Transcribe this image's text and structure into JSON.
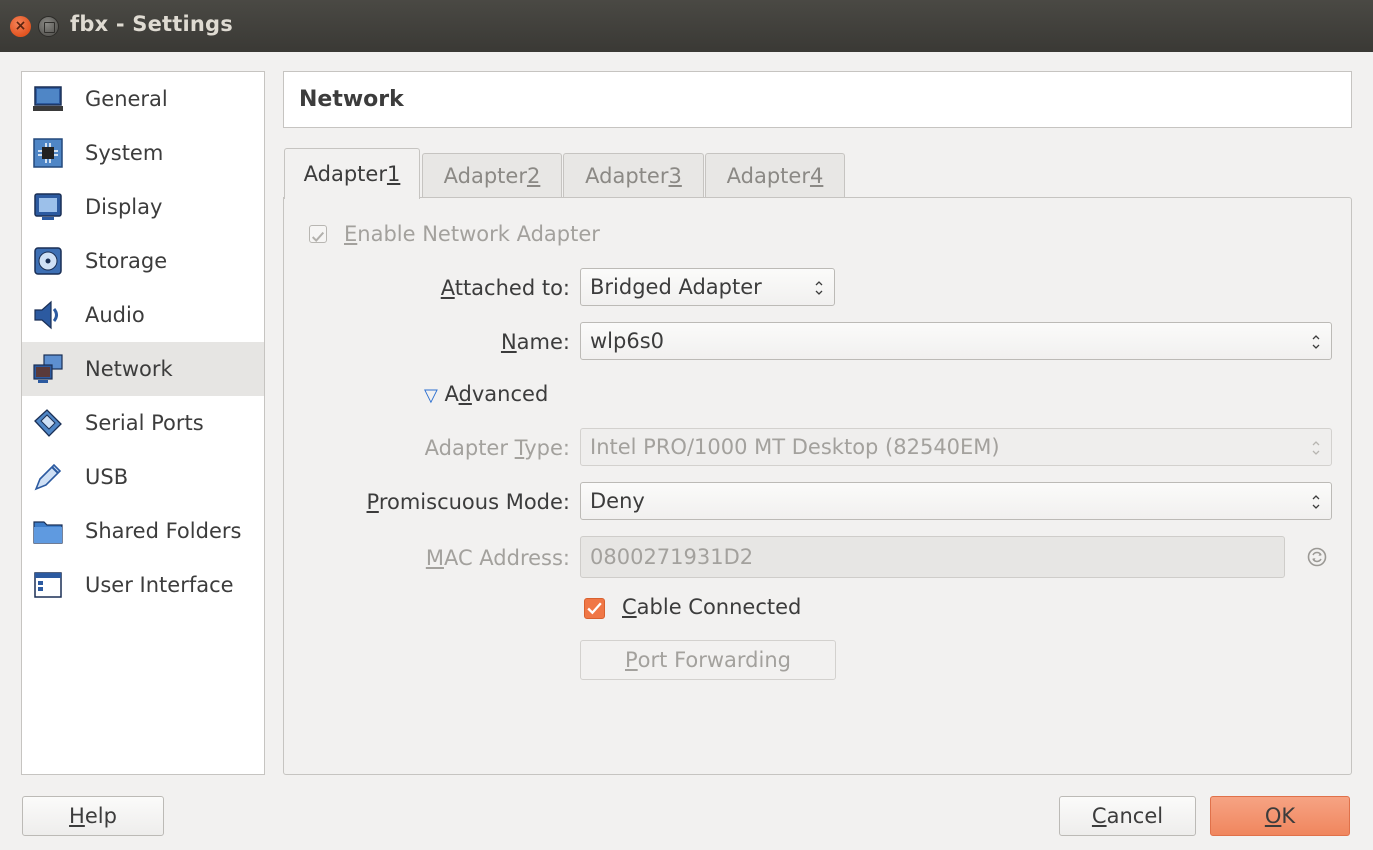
{
  "window": {
    "title": "fbx - Settings",
    "close_glyph": "×"
  },
  "sidebar": {
    "items": [
      {
        "label": "General",
        "icon": "monitor-icon"
      },
      {
        "label": "System",
        "icon": "chip-icon"
      },
      {
        "label": "Display",
        "icon": "display-icon"
      },
      {
        "label": "Storage",
        "icon": "disk-icon"
      },
      {
        "label": "Audio",
        "icon": "speaker-icon"
      },
      {
        "label": "Network",
        "icon": "network-icon",
        "selected": true
      },
      {
        "label": "Serial Ports",
        "icon": "serial-port-icon"
      },
      {
        "label": "USB",
        "icon": "usb-icon"
      },
      {
        "label": "Shared Folders",
        "icon": "folder-icon"
      },
      {
        "label": "User Interface",
        "icon": "window-icon"
      }
    ]
  },
  "page": {
    "title": "Network"
  },
  "tabs": [
    {
      "label_pre": "Adapter ",
      "mnemonic": "1",
      "active": true
    },
    {
      "label_pre": "Adapter ",
      "mnemonic": "2"
    },
    {
      "label_pre": "Adapter ",
      "mnemonic": "3"
    },
    {
      "label_pre": "Adapter ",
      "mnemonic": "4"
    }
  ],
  "adapter": {
    "enable": {
      "mnemonic": "E",
      "rest": "nable Network Adapter",
      "checked": true
    },
    "attached_to": {
      "label_mnemonic": "A",
      "label_rest": "ttached to:",
      "value": "Bridged Adapter"
    },
    "name": {
      "label_mnemonic": "N",
      "label_rest": "ame:",
      "value": "wlp6s0"
    },
    "advanced": {
      "pre": "A",
      "mnemonic": "d",
      "rest": "vanced",
      "expanded_glyph": "▽"
    },
    "adapter_type": {
      "label_pre": "Adapter ",
      "label_mnemonic": "T",
      "label_rest": "ype:",
      "value": "Intel PRO/1000 MT Desktop (82540EM)"
    },
    "promiscuous": {
      "label_mnemonic": "P",
      "label_rest": "romiscuous Mode:",
      "value": "Deny"
    },
    "mac": {
      "label_pre": "",
      "label_mnemonic": "M",
      "label_rest": "AC Address:",
      "value": "0800271931D2"
    },
    "cable": {
      "mnemonic": "C",
      "rest": "able Connected",
      "checked": true
    },
    "port_forwarding": {
      "mnemonic": "P",
      "rest": "ort Forwarding"
    }
  },
  "footer": {
    "help": {
      "mnemonic": "H",
      "rest": "elp"
    },
    "cancel": {
      "mnemonic": "C",
      "rest": "ancel"
    },
    "ok": {
      "mnemonic": "O",
      "rest": "K"
    }
  },
  "colors": {
    "accent": "#f07746",
    "titlebar": "#3c3b37",
    "selected_row": "#e6e5e3"
  }
}
